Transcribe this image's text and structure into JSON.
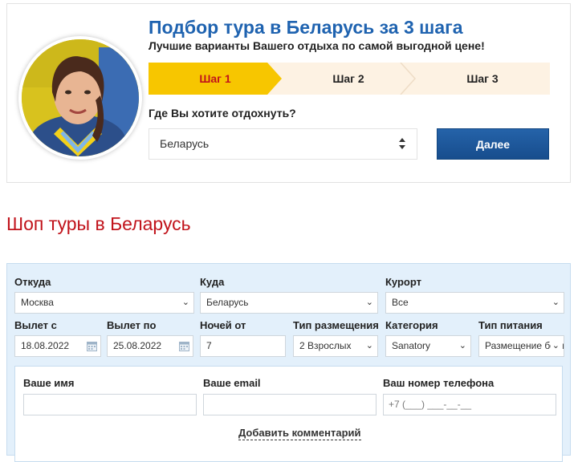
{
  "wizard": {
    "title": "Подбор тура в Беларусь за 3 шага",
    "subtitle": "Лучшие варианты Вашего отдыха по самой выгодной цене!",
    "steps": [
      {
        "label": "Шаг 1",
        "active": true
      },
      {
        "label": "Шаг 2",
        "active": false
      },
      {
        "label": "Шаг 3",
        "active": false
      }
    ],
    "question": "Где Вы хотите отдохнуть?",
    "destination_value": "Беларусь",
    "next_label": "Далее"
  },
  "shop_title": "Шоп туры в Беларусь",
  "search": {
    "from_label": "Откуда",
    "from_value": "Москва",
    "to_label": "Куда",
    "to_value": "Беларусь",
    "resort_label": "Курорт",
    "resort_value": "Все",
    "depart_from_label": "Вылет с",
    "depart_from_value": "18.08.2022",
    "depart_to_label": "Вылет по",
    "depart_to_value": "25.08.2022",
    "nights_label": "Ночей от",
    "nights_value": "7",
    "accommodation_label": "Тип размещения",
    "accommodation_value": "2 Взрослых",
    "category_label": "Категория",
    "category_value": "Sanatory",
    "meal_label": "Тип питания",
    "meal_value": "Размещение без питания"
  },
  "contact": {
    "name_label": "Ваше имя",
    "name_value": "",
    "email_label": "Ваше email",
    "email_value": "",
    "phone_label": "Ваш номер телефона",
    "phone_placeholder": "+7 (___) ___-__-__",
    "comment_link": "Добавить комментарий"
  },
  "colors": {
    "title_blue": "#1f63b0",
    "accent_red": "#c1131b",
    "step_active": "#f7c600",
    "step_bg": "#fdf2e3",
    "button_blue": "#1d579b",
    "form_bg": "#e3f0fb"
  }
}
